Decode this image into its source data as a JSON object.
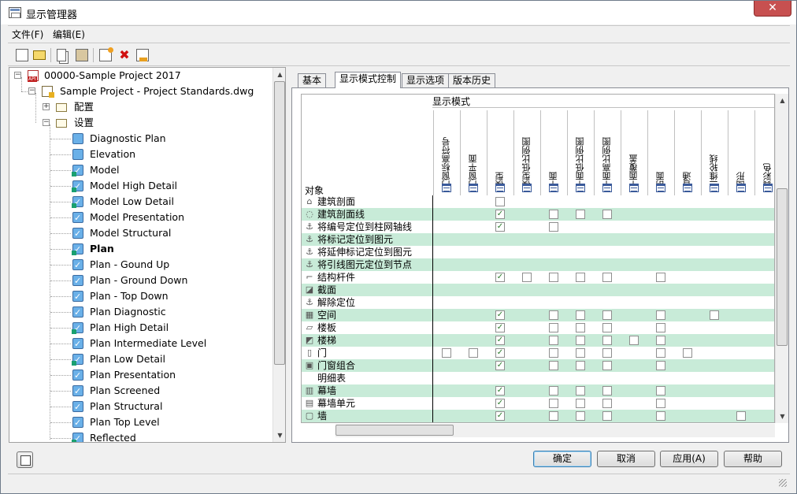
{
  "window": {
    "title": "显示管理器",
    "close_glyph": "✕"
  },
  "menu": [
    "文件(F)",
    "编辑(E)"
  ],
  "toolbar": {
    "icons": [
      "new-icon",
      "open-icon",
      "copy-icon",
      "paste-icon",
      "add-style-icon",
      "delete-icon",
      "purge-icon"
    ]
  },
  "tree": {
    "root": "00000-Sample Project 2017",
    "drawing": "Sample Project - Project Standards.dwg",
    "config_folder": "配置",
    "sets_folder": "设置",
    "sets": [
      {
        "label": "Diagnostic Plan",
        "checked": false,
        "default": false,
        "bold": false
      },
      {
        "label": "Elevation",
        "checked": false,
        "default": false,
        "bold": false
      },
      {
        "label": "Model",
        "checked": true,
        "default": true,
        "bold": false
      },
      {
        "label": "Model High Detail",
        "checked": true,
        "default": true,
        "bold": false
      },
      {
        "label": "Model Low Detail",
        "checked": true,
        "default": true,
        "bold": false
      },
      {
        "label": "Model Presentation",
        "checked": true,
        "default": false,
        "bold": false
      },
      {
        "label": "Model Structural",
        "checked": true,
        "default": false,
        "bold": false
      },
      {
        "label": "Plan",
        "checked": true,
        "default": true,
        "bold": true
      },
      {
        "label": "Plan - Gound Up",
        "checked": true,
        "default": false,
        "bold": false
      },
      {
        "label": "Plan - Ground Down",
        "checked": true,
        "default": false,
        "bold": false
      },
      {
        "label": "Plan - Top Down",
        "checked": true,
        "default": false,
        "bold": false
      },
      {
        "label": "Plan Diagnostic",
        "checked": true,
        "default": false,
        "bold": false
      },
      {
        "label": "Plan High Detail",
        "checked": true,
        "default": true,
        "bold": false
      },
      {
        "label": "Plan Intermediate Level",
        "checked": true,
        "default": false,
        "bold": false
      },
      {
        "label": "Plan Low Detail",
        "checked": true,
        "default": true,
        "bold": false
      },
      {
        "label": "Plan Presentation",
        "checked": true,
        "default": false,
        "bold": false
      },
      {
        "label": "Plan Screened",
        "checked": true,
        "default": false,
        "bold": false
      },
      {
        "label": "Plan Structural",
        "checked": true,
        "default": false,
        "bold": false
      },
      {
        "label": "Plan Top Level",
        "checked": true,
        "default": false,
        "bold": false
      },
      {
        "label": "Reflected",
        "checked": true,
        "default": true,
        "bold": false
      }
    ]
  },
  "tabs": [
    {
      "label": "基本",
      "active": false
    },
    {
      "label": "显示模式控制",
      "active": true
    },
    {
      "label": "显示选项",
      "active": false
    },
    {
      "label": "版本历史",
      "active": false
    }
  ],
  "grid": {
    "mode_header": "显示模式",
    "object_header": "对象",
    "columns": [
      "门窗标高符号",
      "门窗平面",
      "模型",
      "模型低比例图",
      "平面",
      "平面低比例图",
      "平面高比例图",
      "平面覆盖",
      "剖面",
      "普通",
      "三维轮线",
      "图形",
      "真彩色"
    ],
    "rows": [
      {
        "label": "建筑剖面",
        "icon": "building-section-icon",
        "checks": [
          null,
          null,
          false,
          null,
          null,
          null,
          null,
          null,
          null,
          null,
          null,
          null,
          null
        ]
      },
      {
        "label": "建筑剖面线",
        "icon": "section-line-icon",
        "checks": [
          null,
          null,
          true,
          null,
          false,
          false,
          false,
          null,
          null,
          null,
          null,
          null,
          null
        ]
      },
      {
        "label": "将编号定位到柱网轴线",
        "icon": "anchor-icon",
        "checks": [
          null,
          null,
          true,
          null,
          false,
          null,
          null,
          null,
          null,
          null,
          null,
          null,
          null
        ]
      },
      {
        "label": "将标记定位到图元",
        "icon": "anchor-icon",
        "checks": [
          null,
          null,
          null,
          null,
          null,
          null,
          null,
          null,
          null,
          null,
          null,
          null,
          null
        ]
      },
      {
        "label": "将延伸标记定位到图元",
        "icon": "anchor-icon",
        "checks": [
          null,
          null,
          null,
          null,
          null,
          null,
          null,
          null,
          null,
          null,
          null,
          null,
          null
        ]
      },
      {
        "label": "将引线图元定位到节点",
        "icon": "anchor-icon",
        "checks": [
          null,
          null,
          null,
          null,
          null,
          null,
          null,
          null,
          null,
          null,
          null,
          null,
          null
        ]
      },
      {
        "label": "结构杆件",
        "icon": "member-icon",
        "checks": [
          null,
          null,
          true,
          false,
          false,
          false,
          false,
          null,
          false,
          null,
          null,
          null,
          null
        ]
      },
      {
        "label": "截面",
        "icon": "profile-icon",
        "checks": [
          null,
          null,
          null,
          null,
          null,
          null,
          null,
          null,
          null,
          null,
          null,
          null,
          null
        ]
      },
      {
        "label": "解除定位",
        "icon": "release-anchor-icon",
        "checks": [
          null,
          null,
          null,
          null,
          null,
          null,
          null,
          null,
          null,
          null,
          null,
          null,
          null
        ]
      },
      {
        "label": "空间",
        "icon": "space-icon",
        "checks": [
          null,
          null,
          true,
          null,
          false,
          false,
          false,
          null,
          false,
          null,
          false,
          null,
          null
        ]
      },
      {
        "label": "楼板",
        "icon": "slab-icon",
        "checks": [
          null,
          null,
          true,
          null,
          false,
          false,
          false,
          null,
          false,
          null,
          null,
          null,
          null
        ]
      },
      {
        "label": "楼梯",
        "icon": "stair-icon",
        "checks": [
          null,
          null,
          true,
          null,
          false,
          false,
          false,
          false,
          false,
          null,
          null,
          null,
          null
        ]
      },
      {
        "label": "门",
        "icon": "door-icon",
        "checks": [
          false,
          false,
          true,
          null,
          false,
          false,
          false,
          null,
          false,
          false,
          null,
          null,
          null
        ]
      },
      {
        "label": "门窗组合",
        "icon": "door-window-assembly-icon",
        "checks": [
          null,
          null,
          true,
          null,
          false,
          false,
          false,
          null,
          false,
          null,
          null,
          null,
          null
        ]
      },
      {
        "label": "明细表",
        "icon": "schedule-icon",
        "checks": [
          null,
          null,
          null,
          null,
          null,
          null,
          null,
          null,
          null,
          null,
          null,
          null,
          null
        ]
      },
      {
        "label": "幕墙",
        "icon": "curtain-wall-icon",
        "checks": [
          null,
          null,
          true,
          null,
          false,
          false,
          false,
          null,
          false,
          null,
          null,
          null,
          null
        ]
      },
      {
        "label": "幕墙单元",
        "icon": "curtain-wall-unit-icon",
        "checks": [
          null,
          null,
          true,
          null,
          false,
          false,
          false,
          null,
          false,
          null,
          null,
          null,
          null
        ]
      },
      {
        "label": "墙",
        "icon": "wall-icon",
        "checks": [
          null,
          null,
          true,
          null,
          false,
          false,
          false,
          null,
          false,
          null,
          null,
          false,
          null
        ]
      }
    ]
  },
  "buttons": {
    "ok": "确定",
    "cancel": "取消",
    "apply": "应用(A)",
    "help": "帮助"
  },
  "colors": {
    "row_alt": "#c8ebd8",
    "check": "#2a7a2a",
    "close": "#c75050"
  }
}
